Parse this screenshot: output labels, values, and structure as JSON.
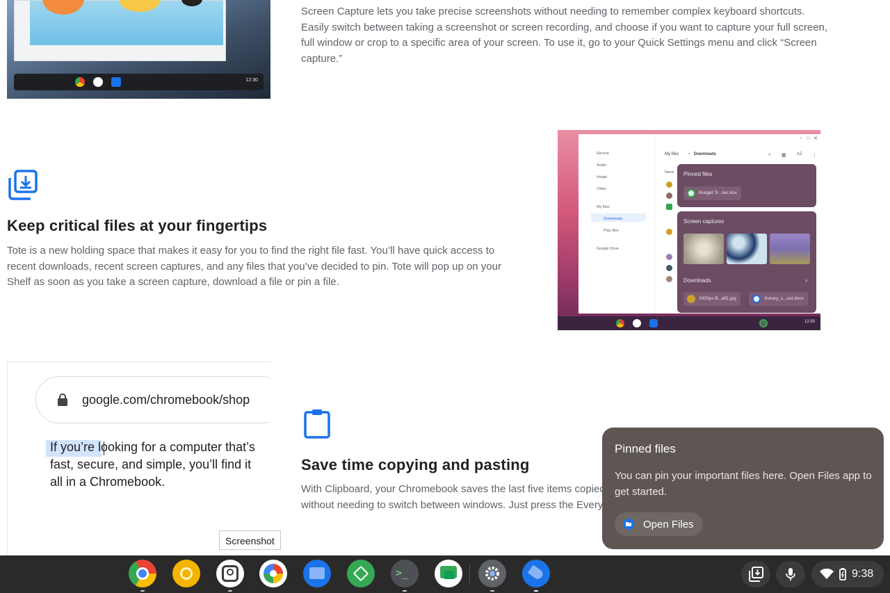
{
  "sections": {
    "screen_capture": {
      "description": "Screen Capture lets you take precise screenshots without needing to remember complex keyboard shortcuts. Easily switch between taking a screenshot or screen recording, and choose if you want to capture your full screen, full window or crop to a specific area of your screen. To use it, go to your Quick Settings menu and click “Screen capture.”",
      "thumbnail": {
        "clock": "12:30"
      }
    },
    "tote": {
      "title": "Keep critical files at your fingertips",
      "description": "Tote is a new holding space that makes it easy for you to find the right file fast. You’ll have quick access to recent downloads, recent screen captures, and any files that you’ve decided to pin. Tote will pop up on your Shelf as soon as you take a screen capture, download a file or pin a file.",
      "thumbnail": {
        "sidebar": [
          "Recent",
          "Audio",
          "Image",
          "Video",
          "My files",
          "Downloads",
          "Play files",
          "Google Drive"
        ],
        "breadcrumb_root": "My files",
        "breadcrumb_current": "Downloads",
        "list_header": "Name",
        "sort_label": "AZ",
        "pinned_title": "Pinned files",
        "pinned_file": "Budget Tr...ker.xlsx",
        "captures_title": "Screen captures",
        "downloads_title": "Downloads",
        "downloads_chevron": "›",
        "download_files": [
          "1920px B...afi1.jpg",
          "Survey_s...ool.docx"
        ],
        "clock": "12:30"
      }
    },
    "clipboard": {
      "title": "Save time copying and pasting",
      "description_line1": "With Clipboard, your Chromebook saves the last five items copied s",
      "description_line2": "without needing to switch between windows. Just press the Everyth",
      "thumbnail": {
        "url": "google.com/chromebook/shop",
        "paragraph": "If you’re looking for a computer that’s fast, secure, and simple, you’ll find it all in a Chromebook."
      }
    }
  },
  "tooltip": "Screenshot",
  "pinned_bubble": {
    "title": "Pinned files",
    "body": "You can pin your important files here. Open Files app to get started.",
    "button": "Open Files"
  },
  "shelf": {
    "apps": [
      "Chrome",
      "Chrome Canary",
      "Camera",
      "Google Photos",
      "Files",
      "Maps Navigation",
      "Terminal",
      "Google Chat",
      "Settings",
      "Explore"
    ],
    "time": "9:38"
  },
  "colors": {
    "accent_blue": "#1a73e8",
    "bubble_bg": "#5e5653",
    "shelf_bg": "#2b2a2a"
  }
}
